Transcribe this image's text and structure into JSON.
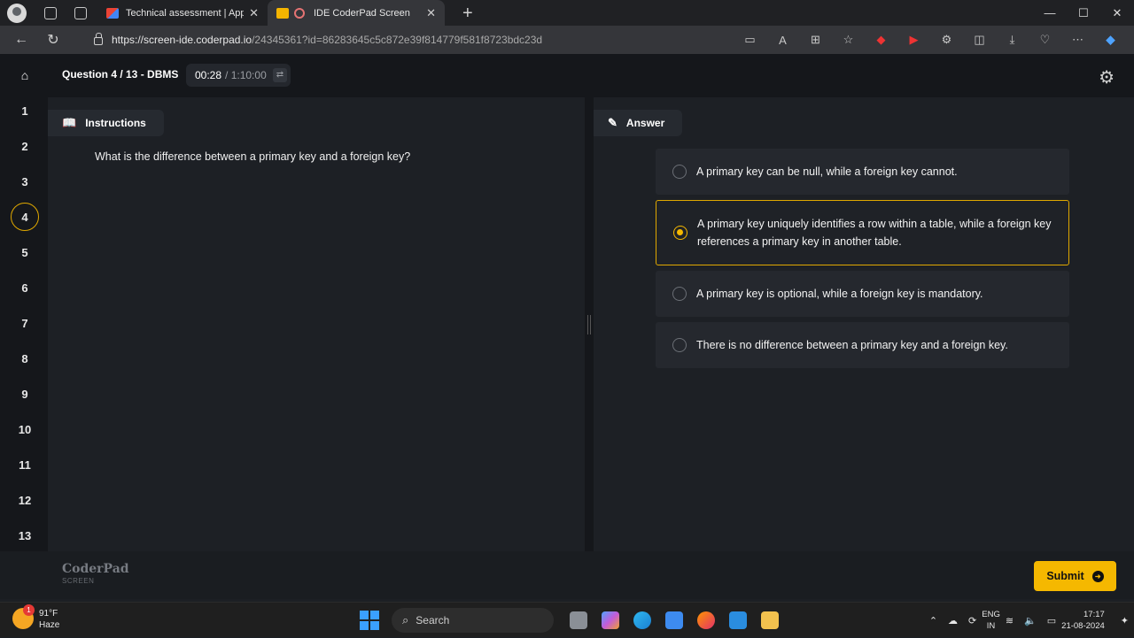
{
  "browser": {
    "tabs": [
      {
        "label": "Technical assessment | Apple Ind",
        "favicon": "gmail-icon"
      },
      {
        "label": "IDE CoderPad Screen",
        "favicon": "coderpad-icon",
        "active": true
      }
    ],
    "url_host": "https://screen-ide.coderpad.io",
    "url_path": "/24345361?id=86283645c5c872e39f814779f581f8723bdc23d",
    "window_controls": [
      "—",
      "☐",
      "✕"
    ]
  },
  "app": {
    "question_nav": [
      "1",
      "2",
      "3",
      "4",
      "5",
      "6",
      "7",
      "8",
      "9",
      "10",
      "11",
      "12",
      "13"
    ],
    "active_question": "4",
    "header_title": "Question 4 / 13 - DBMS",
    "timer_elapsed": "00:28",
    "timer_total": "/ 1:10:00",
    "instructions_label": "Instructions",
    "answer_label": "Answer",
    "question_text": "What is the difference between a primary key and a foreign key?",
    "options": [
      {
        "label": "A primary key can be null, while a foreign key cannot.",
        "selected": false
      },
      {
        "label": "A primary key uniquely identifies a row within a table, while a foreign key references a primary key in another table.",
        "selected": true
      },
      {
        "label": "A primary key is optional, while a foreign key is mandatory.",
        "selected": false
      },
      {
        "label": "There is no difference between a primary key and a foreign key.",
        "selected": false
      }
    ],
    "brand_name": "CoderPad",
    "brand_sub": "SCREEN",
    "submit_label": "Submit",
    "accent_color": "#f5b800"
  },
  "taskbar": {
    "weather_temp": "91°F",
    "weather_desc": "Haze",
    "weather_badge": "1",
    "search_placeholder": "Search",
    "lang_top": "ENG",
    "lang_bottom": "IN",
    "time": "17:17",
    "date": "21-08-2024"
  }
}
